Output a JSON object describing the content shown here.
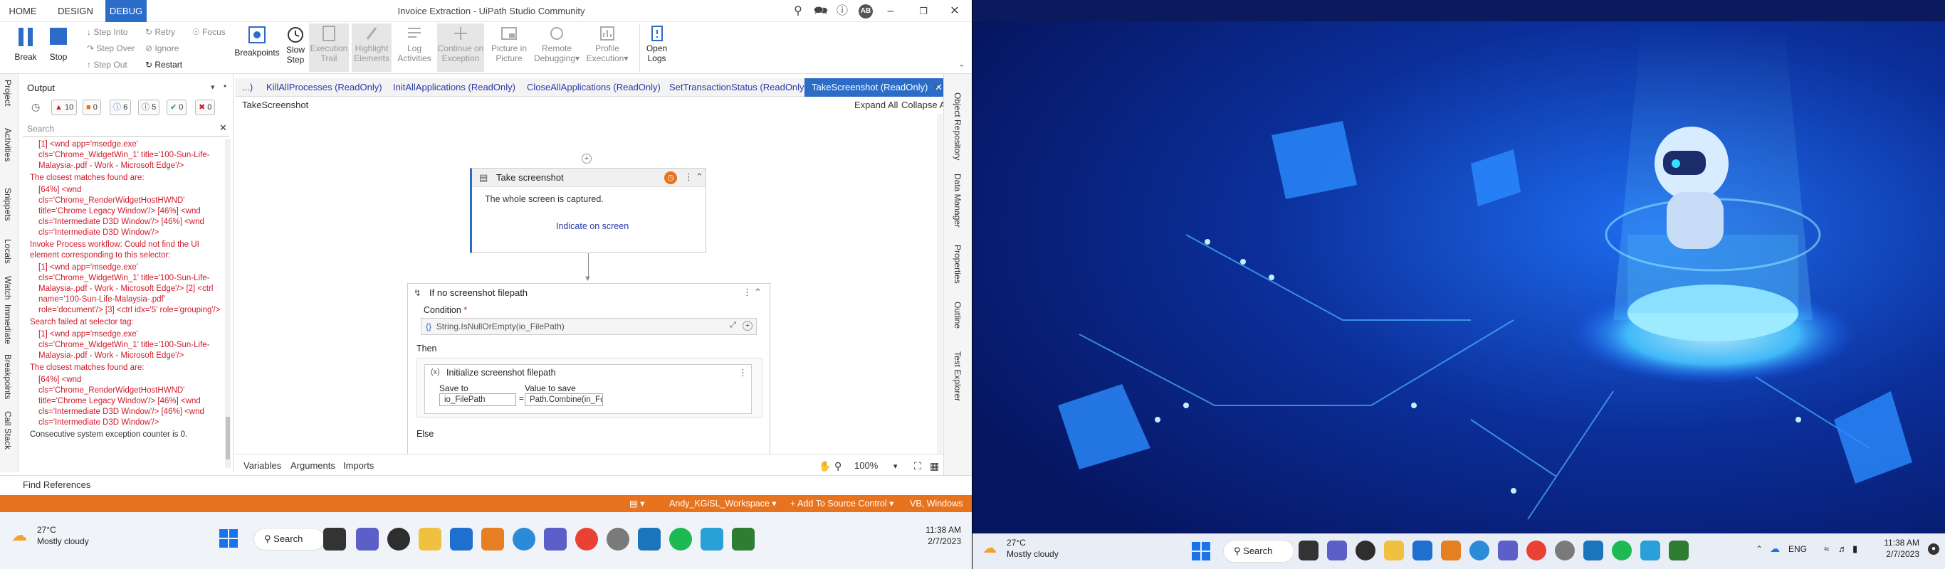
{
  "window": {
    "title": "Invoice Extraction - UiPath Studio Community",
    "ribbon_tabs": [
      "HOME",
      "DESIGN",
      "DEBUG"
    ],
    "user_initials": "AB"
  },
  "ribbon": {
    "break": "Break",
    "stop": "Stop",
    "step_into": "Step Into",
    "step_over": "Step Over",
    "step_out": "Step Out",
    "retry": "Retry",
    "ignore": "Ignore",
    "restart": "Restart",
    "focus": "Focus",
    "breakpoints": "Breakpoints",
    "slow_step_1": "Slow",
    "slow_step_2": "Step",
    "execution_trail_1": "Execution",
    "execution_trail_2": "Trail",
    "highlight_elements_1": "Highlight",
    "highlight_elements_2": "Elements",
    "log_activities_1": "Log",
    "log_activities_2": "Activities",
    "continue_exception_1": "Continue on",
    "continue_exception_2": "Exception",
    "picture_in_picture_1": "Picture in",
    "picture_in_picture_2": "Picture",
    "remote_debugging_1": "Remote",
    "remote_debugging_2": "Debugging",
    "profile_execution_1": "Profile",
    "profile_execution_2": "Execution",
    "open_logs_1": "Open",
    "open_logs_2": "Logs"
  },
  "left_tabs": [
    "Project",
    "Activities",
    "Snippets",
    "Locals",
    "Watch",
    "Immediate",
    "Breakpoints",
    "Call Stack"
  ],
  "output": {
    "title": "Output",
    "counts": {
      "errors": "10",
      "warnings": "0",
      "info": "6",
      "trace": "5",
      "success": "0",
      "fail": "0"
    },
    "search_placeholder": "Search",
    "lines": [
      {
        "cls": "ind",
        "text": "[1] <wnd app='msedge.exe' cls='Chrome_WidgetWin_1' title='100-Sun-Life-Malaysia-.pdf - Work - Microsoft Edge'/>"
      },
      {
        "cls": "first",
        "text": "The closest matches found are:"
      },
      {
        "cls": "ind",
        "text": "[64%] <wnd cls='Chrome_RenderWidgetHostHWND' title='Chrome Legacy Window'/> [46%] <wnd cls='Intermediate D3D Window'/> [46%] <wnd cls='Intermediate D3D Window'/>"
      },
      {
        "cls": "first",
        "text": "Invoke Process workflow: Could not find the UI element corresponding to this selector:"
      },
      {
        "cls": "ind",
        "text": "[1] <wnd app='msedge.exe' cls='Chrome_WidgetWin_1' title='100-Sun-Life-Malaysia-.pdf - Work - Microsoft Edge'/> [2] <ctrl name='100-Sun-Life-Malaysia-.pdf' role='document'/> [3] <ctrl idx='5' role='grouping'/>"
      },
      {
        "cls": "first",
        "text": "Search failed at selector tag:"
      },
      {
        "cls": "ind",
        "text": "[1] <wnd app='msedge.exe' cls='Chrome_WidgetWin_1' title='100-Sun-Life-Malaysia-.pdf - Work - Microsoft Edge'/>"
      },
      {
        "cls": "first",
        "text": "The closest matches found are:"
      },
      {
        "cls": "ind",
        "text": "[64%] <wnd cls='Chrome_RenderWidgetHostHWND' title='Chrome Legacy Window'/> [46%] <wnd cls='Intermediate D3D Window'/> [46%] <wnd cls='Intermediate D3D Window'/>"
      },
      {
        "cls": "first ok",
        "text": "Consecutive system exception counter is 0."
      }
    ]
  },
  "doc_tabs": [
    "...)",
    "KillAllProcesses (ReadOnly)",
    "InitAllApplications (ReadOnly)",
    "CloseAllApplications (ReadOnly)",
    "SetTransactionStatus (ReadOnly)",
    "TakeScreenshot (ReadOnly)"
  ],
  "editor": {
    "breadcrumb": "TakeScreenshot",
    "expand_all": "Expand All",
    "collapse_all": "Collapse All",
    "take_screenshot": {
      "title": "Take screenshot",
      "desc": "The whole screen is captured.",
      "indicate": "Indicate on screen"
    },
    "if_block": {
      "title": "If no screenshot filepath",
      "condition_label": "Condition",
      "condition_value": "String.IsNullOrEmpty(io_FilePath)",
      "then_label": "Then",
      "else_label": "Else"
    },
    "assign": {
      "title": "Initialize screenshot filepath",
      "save_to_label": "Save to",
      "save_to_value": "io_FilePath",
      "value_label": "Value to save",
      "value_value": "Path.Combine(in_Folder, \"Excepti"
    },
    "bottom_tabs": [
      "Variables",
      "Arguments",
      "Imports"
    ],
    "zoom": "100%"
  },
  "right_tabs": [
    "Object Repository",
    "Data Manager",
    "Properties",
    "Outline",
    "Test Explorer"
  ],
  "find_references": "Find References",
  "statusbar": {
    "workspace": "Andy_KGiSL_Workspace",
    "source_control": "Add To Source Control",
    "language": "VB, Windows"
  },
  "taskbar": {
    "weather_temp": "27°C",
    "weather_desc": "Mostly cloudy",
    "search_label": "Search",
    "time": "11:38 AM",
    "date": "2/7/2023",
    "lang": "ENG"
  },
  "colors": {
    "accent": "#2b6cc9",
    "statusbar": "#e8731e",
    "error_text": "#d11a2a"
  }
}
